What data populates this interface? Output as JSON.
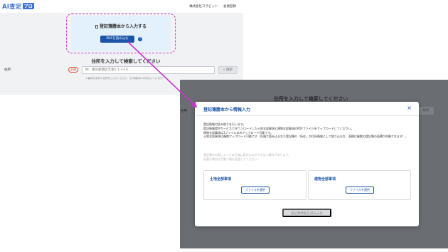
{
  "app": {
    "logo_main": "AI查定",
    "logo_badge": "プロ",
    "header_links": [
      "株式会社コラビット",
      "会員登録"
    ]
  },
  "upload_card": {
    "icon": "document-icon",
    "title": "登記簿謄本から入力する",
    "button_label": "PDFを読み込む",
    "help_icon": "?"
  },
  "search": {
    "heading": "住所を入力して検索してください",
    "address_label": "住所",
    "required_badge": "必須",
    "input_placeholder": "例：東京都港区芝浦1-1-3-10",
    "hint": "＊番地を含めた住所をご入力ください（日本国内のみ対応しています）",
    "search_button": "検索"
  },
  "overlay_bg": {
    "heading": "住所を入力して検索してください",
    "label": "住所",
    "button": "検索"
  },
  "modal": {
    "title": "登記簿謄本から情報入力",
    "close_icon": "×",
    "description": [
      "登記情報の読み取りを行います。",
      "登記情報提供サービスでダウンロードした土地全部事項と建物全部事項のPDFファイルをアップロードしてください。",
      "建物全部事項は1ファイルのみアップロード可能です。",
      "土地全部事項は複数アップロード可能です（先頭で読み込まれた登記簿の「所在」が住所情報として取り込まれ、面積は複数の登記簿の面積が合算されます）。"
    ],
    "notes": [
      "登記簿の内容によっては正確に読み込みができない場合があります。",
      "必要な場合は手動で値を変更してください。"
    ],
    "land_card": {
      "title": "土地全部事項",
      "button": "ファイルを選択"
    },
    "building_card": {
      "title": "建物全部事項",
      "button": "ファイルを選択"
    },
    "submit_button": "登記簿情報を読み込む"
  },
  "colors": {
    "accent": "#1b55a6",
    "highlight": "#d033d0",
    "required": "#e5533d",
    "card_bg": "#e2f1fb"
  }
}
